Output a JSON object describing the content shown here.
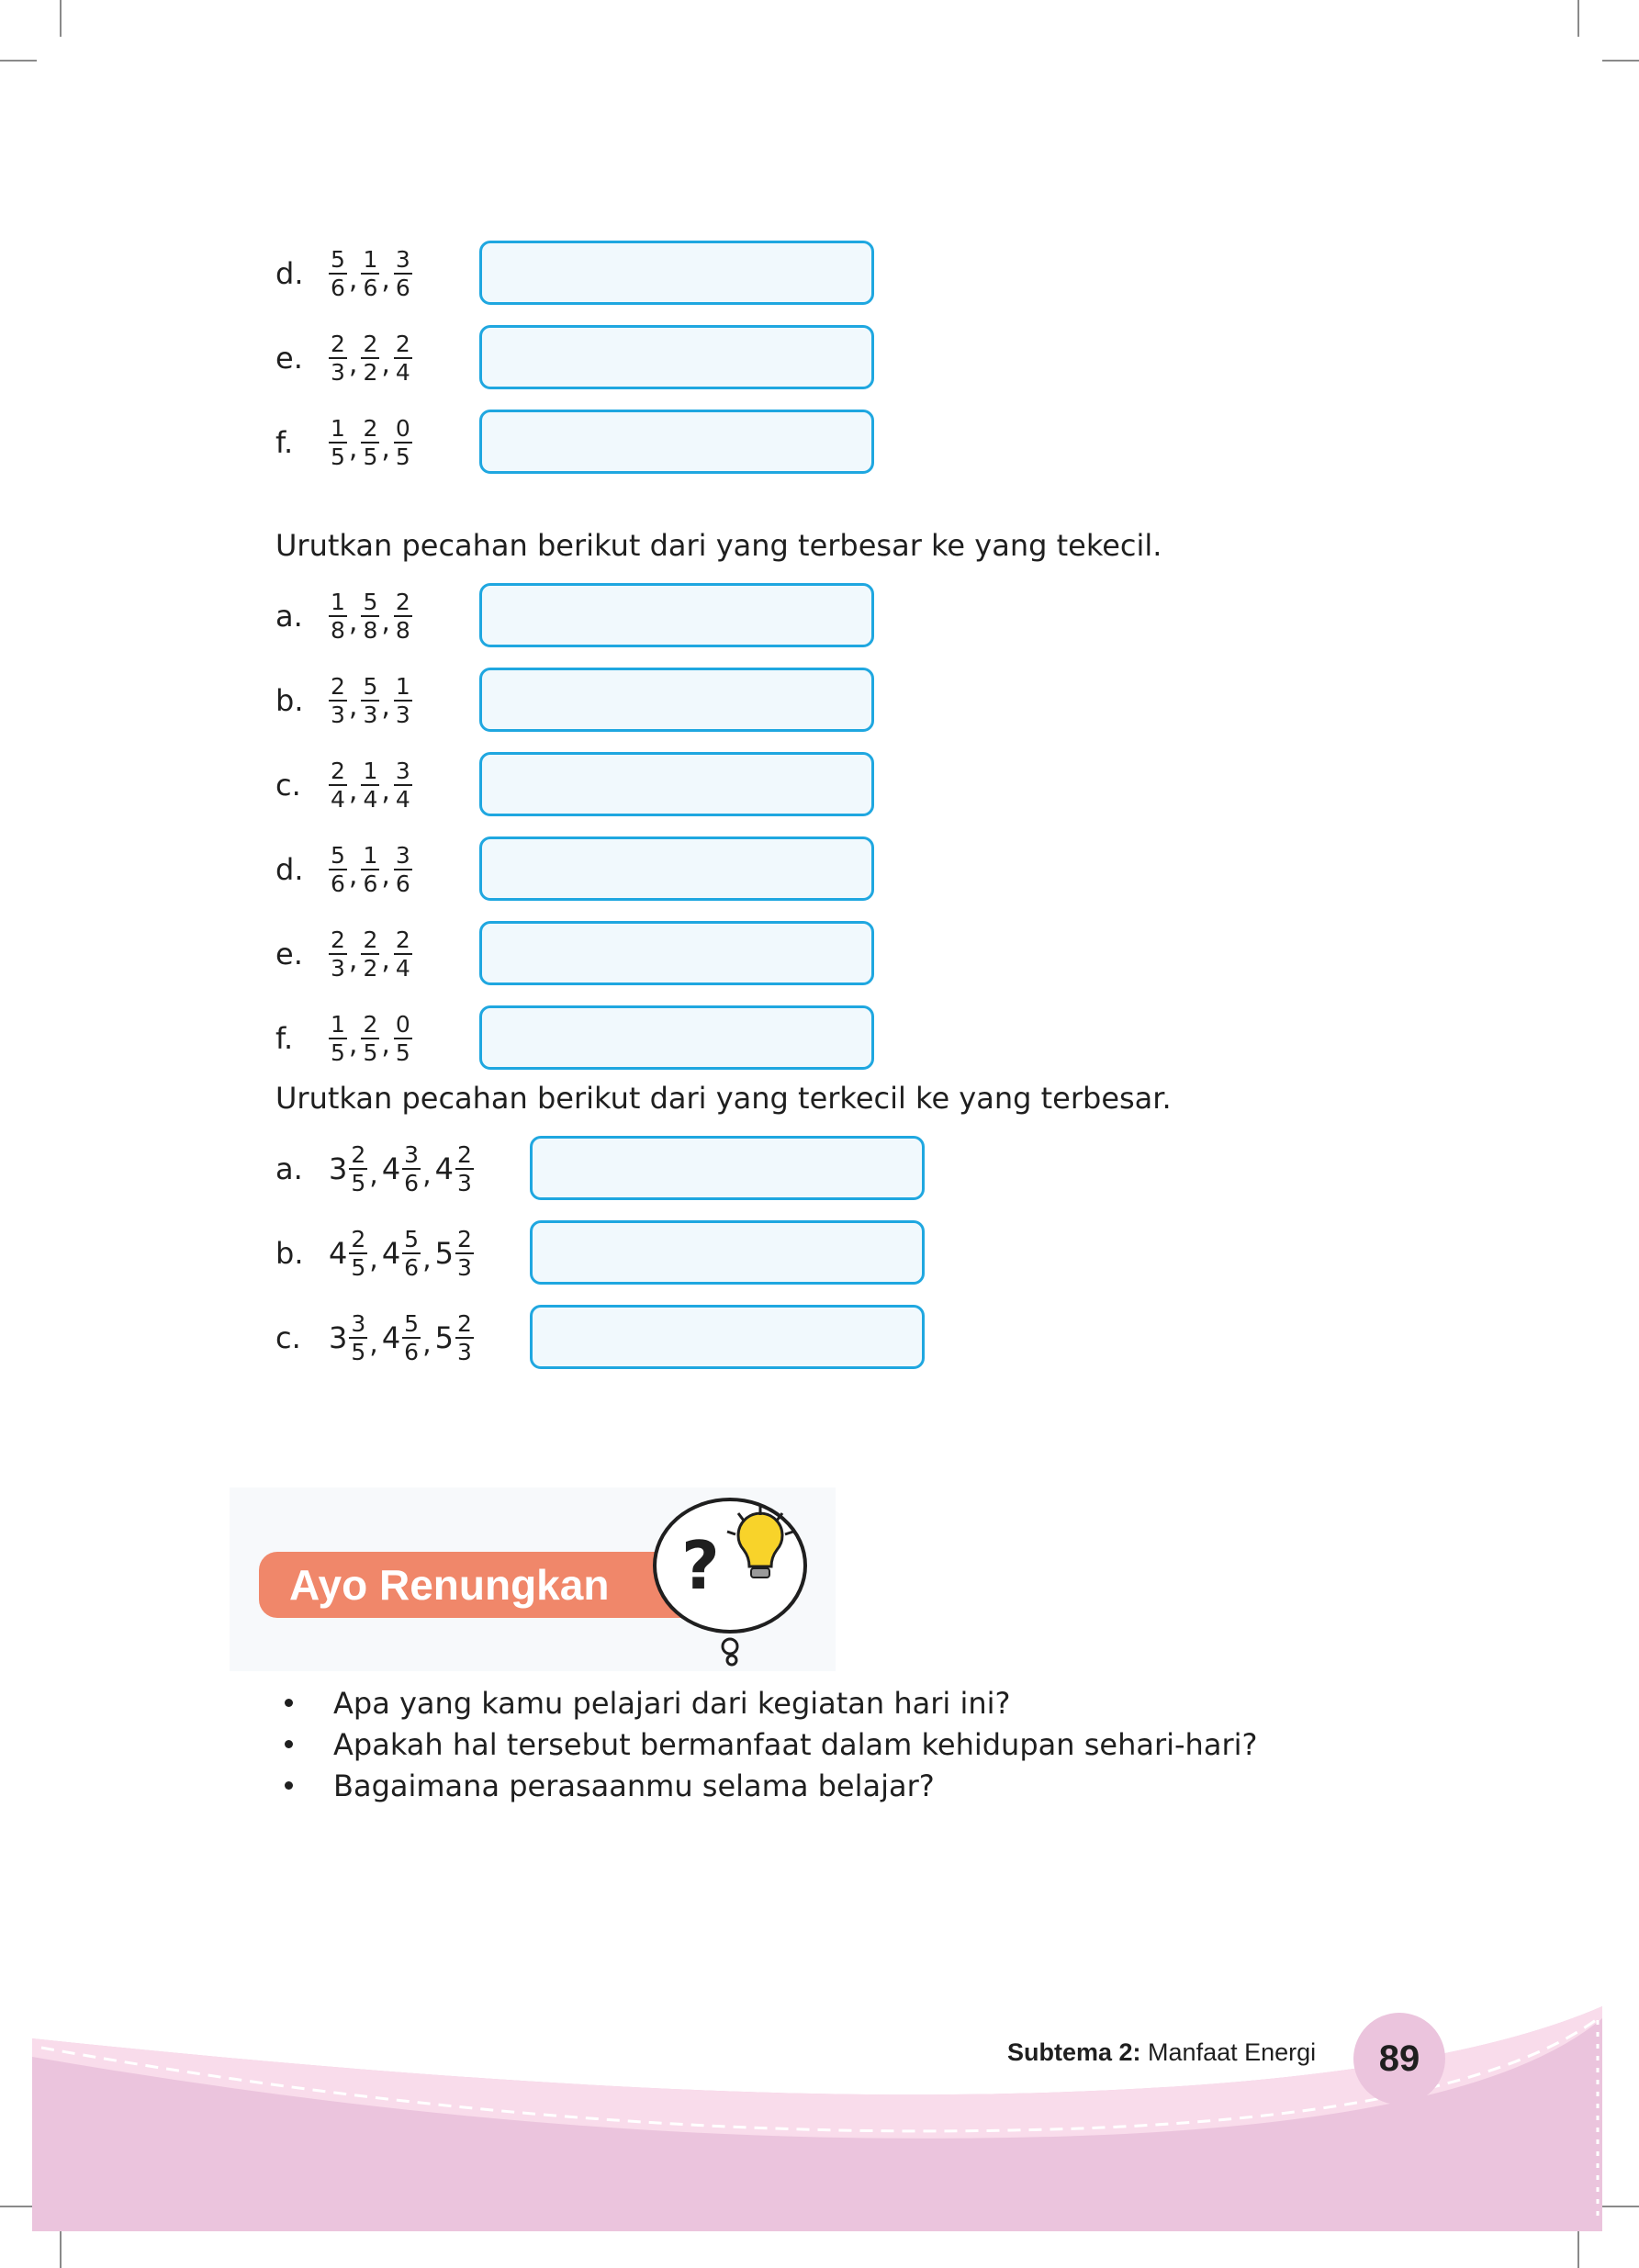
{
  "section1": {
    "items": [
      {
        "letter": "d.",
        "fractions": [
          {
            "n": "5",
            "d": "6"
          },
          {
            "n": "1",
            "d": "6"
          },
          {
            "n": "3",
            "d": "6"
          }
        ]
      },
      {
        "letter": "e.",
        "fractions": [
          {
            "n": "2",
            "d": "3"
          },
          {
            "n": "2",
            "d": "2"
          },
          {
            "n": "2",
            "d": "4"
          }
        ]
      },
      {
        "letter": "f.",
        "fractions": [
          {
            "n": "1",
            "d": "5"
          },
          {
            "n": "2",
            "d": "5"
          },
          {
            "n": "0",
            "d": "5"
          }
        ]
      }
    ]
  },
  "section2": {
    "instruction": "Urutkan pecahan berikut dari yang terbesar ke yang tekecil.",
    "items": [
      {
        "letter": "a.",
        "fractions": [
          {
            "n": "1",
            "d": "8"
          },
          {
            "n": "5",
            "d": "8"
          },
          {
            "n": "2",
            "d": "8"
          }
        ]
      },
      {
        "letter": "b.",
        "fractions": [
          {
            "n": "2",
            "d": "3"
          },
          {
            "n": "5",
            "d": "3"
          },
          {
            "n": "1",
            "d": "3"
          }
        ]
      },
      {
        "letter": "c.",
        "fractions": [
          {
            "n": "2",
            "d": "4"
          },
          {
            "n": "1",
            "d": "4"
          },
          {
            "n": "3",
            "d": "4"
          }
        ]
      },
      {
        "letter": "d.",
        "fractions": [
          {
            "n": "5",
            "d": "6"
          },
          {
            "n": "1",
            "d": "6"
          },
          {
            "n": "3",
            "d": "6"
          }
        ]
      },
      {
        "letter": "e.",
        "fractions": [
          {
            "n": "2",
            "d": "3"
          },
          {
            "n": "2",
            "d": "2"
          },
          {
            "n": "2",
            "d": "4"
          }
        ]
      },
      {
        "letter": "f.",
        "fractions": [
          {
            "n": "1",
            "d": "5"
          },
          {
            "n": "2",
            "d": "5"
          },
          {
            "n": "0",
            "d": "5"
          }
        ]
      }
    ]
  },
  "section3": {
    "instruction": "Urutkan pecahan berikut dari yang terkecil ke yang terbesar.",
    "items": [
      {
        "letter": "a.",
        "fractions": [
          {
            "w": "3",
            "n": "2",
            "d": "5"
          },
          {
            "w": "4",
            "n": "3",
            "d": "6"
          },
          {
            "w": "4",
            "n": "2",
            "d": "3"
          }
        ]
      },
      {
        "letter": "b.",
        "fractions": [
          {
            "w": "4",
            "n": "2",
            "d": "5"
          },
          {
            "w": "4",
            "n": "5",
            "d": "6"
          },
          {
            "w": "5",
            "n": "2",
            "d": "3"
          }
        ]
      },
      {
        "letter": "c.",
        "fractions": [
          {
            "w": "3",
            "n": "3",
            "d": "5"
          },
          {
            "w": "4",
            "n": "5",
            "d": "6"
          },
          {
            "w": "5",
            "n": "2",
            "d": "3"
          }
        ]
      }
    ]
  },
  "reflection": {
    "title": "Ayo Renungkan",
    "icons": [
      "question-mark-icon",
      "lightbulb-icon"
    ],
    "bullets": [
      "Apa yang kamu pelajari dari kegiatan hari ini?",
      "Apakah hal tersebut bermanfaat dalam kehidupan sehari-hari?",
      "Bagaimana perasaanmu selama belajar?"
    ]
  },
  "footer": {
    "subtema_label": "Subtema 2:",
    "subtema_name": " Manfaat Energi",
    "page_number": "89",
    "colors": {
      "band": "#ebc4dd",
      "band_light": "#f9dceb",
      "page_circle": "#ebc4dd"
    }
  },
  "colors": {
    "answer_box_border": "#1fa7e0",
    "answer_box_fill": "#f1f9fd",
    "title_pill": "#f0876a"
  }
}
